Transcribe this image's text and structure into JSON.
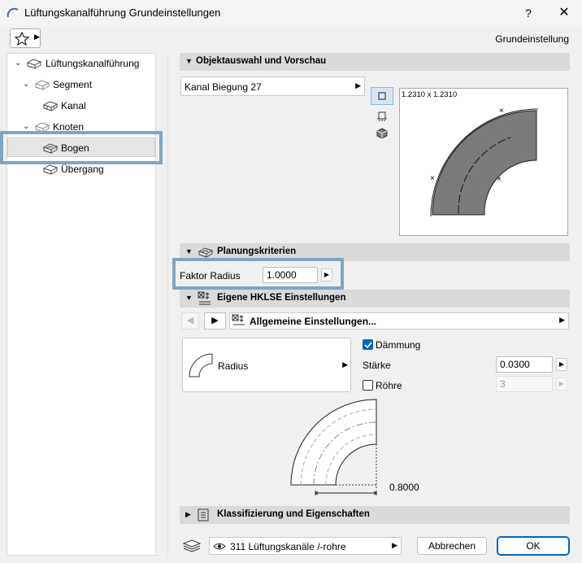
{
  "window": {
    "title": "Lüftungskanalführung Grundeinstellungen",
    "help": "?",
    "close": "✕"
  },
  "header": {
    "preset_label": "Grundeinstellung"
  },
  "tree": {
    "items": [
      {
        "label": "Lüftungskanalführung"
      },
      {
        "label": "Segment"
      },
      {
        "label": "Kanal"
      },
      {
        "label": "Knoten"
      },
      {
        "label": "Bogen"
      },
      {
        "label": "Übergang"
      }
    ]
  },
  "object_section": {
    "title": "Objektauswahl und Vorschau",
    "object_name": "Kanal Biegung 27",
    "preview_size": "1.2310 x 1.2310"
  },
  "planning_section": {
    "title": "Planungskriterien",
    "factor_label": "Faktor Radius",
    "factor_value": "1.0000"
  },
  "hklse_section": {
    "title": "Eigene HKLSE Einstellungen",
    "general_settings": "Allgemeine Einstellungen...",
    "radius_label": "Radius",
    "insulation_label": "Dämmung",
    "insulation_checked": true,
    "thickness_label": "Stärke",
    "thickness_value": "0.0300",
    "tubes_label": "Röhre",
    "tubes_checked": false,
    "tubes_value": "3",
    "dimension_value": "0.8000"
  },
  "classification_section": {
    "title": "Klassifizierung und Eigenschaften"
  },
  "footer": {
    "layer": "311 Lüftungskanäle /-rohre",
    "cancel": "Abbrechen",
    "ok": "OK"
  },
  "colors": {
    "highlight": "#7ea6c3",
    "accent": "#0067c0",
    "section_bg": "#dadada"
  }
}
